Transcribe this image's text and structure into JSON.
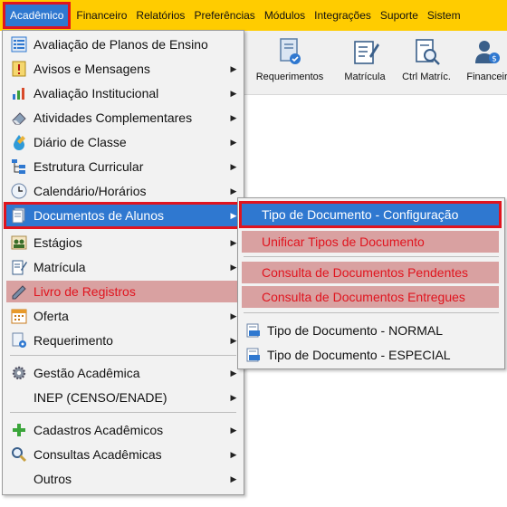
{
  "menubar": {
    "items": [
      {
        "label": "Acadêmico"
      },
      {
        "label": "Financeiro"
      },
      {
        "label": "Relatórios"
      },
      {
        "label": "Preferências"
      },
      {
        "label": "Módulos"
      },
      {
        "label": "Integrações"
      },
      {
        "label": "Suporte"
      },
      {
        "label": "Sistem"
      }
    ]
  },
  "toolbar": {
    "buttons": [
      {
        "label": "Requerimentos",
        "icon": "document-check-icon"
      },
      {
        "label": "Matrícula",
        "icon": "form-pen-icon"
      },
      {
        "label": "Ctrl Matríc.",
        "icon": "document-search-icon"
      },
      {
        "label": "Financeir",
        "icon": "person-money-icon"
      }
    ]
  },
  "academico_menu": {
    "items": [
      {
        "label": "Avaliação de Planos de Ensino",
        "icon": "list-grid-icon"
      },
      {
        "label": "Avisos e Mensagens",
        "icon": "exclamation-icon"
      },
      {
        "label": "Avaliação Institucional",
        "icon": "chart-icon"
      },
      {
        "label": "Atividades Complementares",
        "icon": "eraser-icon"
      },
      {
        "label": "Diário de Classe",
        "icon": "droplet-icon"
      },
      {
        "label": "Estrutura Curricular",
        "icon": "tree-icon"
      },
      {
        "label": "Calendário/Horários",
        "icon": "calendar-clock-icon"
      },
      {
        "label": "Documentos de Alunos",
        "icon": "documents-icon"
      },
      {
        "label": "Estágios",
        "icon": "people-icon"
      },
      {
        "label": "Matrícula",
        "icon": "form-pen-icon"
      },
      {
        "label": "Livro de Registros",
        "icon": "pencil-icon"
      },
      {
        "label": "Oferta",
        "icon": "calendar-icon"
      },
      {
        "label": "Requerimento",
        "icon": "gear-doc-icon"
      },
      {
        "label": "Gestão Acadêmica",
        "icon": "gear-icon"
      },
      {
        "label": "INEP (CENSO/ENADE)",
        "icon": ""
      },
      {
        "label": "Cadastros Acadêmicos",
        "icon": "plus-icon"
      },
      {
        "label": "Consultas Acadêmicas",
        "icon": "search-icon"
      },
      {
        "label": "Outros",
        "icon": ""
      }
    ]
  },
  "documentos_submenu": {
    "items": [
      {
        "label": "Tipo de Documento - Configuração"
      },
      {
        "label": "Unificar Tipos de Documento"
      },
      {
        "label": "Consulta de Documentos Pendentes"
      },
      {
        "label": "Consulta de Documentos Entregues"
      },
      {
        "label": "Tipo de Documento - NORMAL",
        "icon": "doc-card-icon"
      },
      {
        "label": "Tipo de Documento - ESPECIAL",
        "icon": "doc-card-icon"
      }
    ]
  },
  "colors": {
    "menubar": "#ffcc00",
    "selection": "#2f78d0",
    "highlight_border": "#e0141e",
    "pink_row": "#d9a1a1"
  }
}
